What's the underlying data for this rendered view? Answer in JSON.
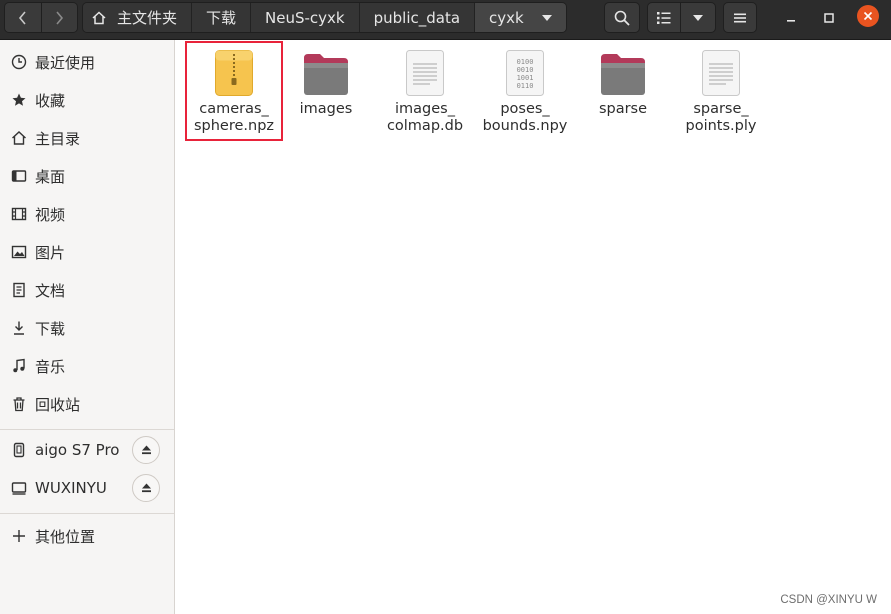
{
  "breadcrumbs": [
    "主文件夹",
    "下载",
    "NeuS-cyxk",
    "public_data",
    "cyxk"
  ],
  "sidebar": {
    "places": [
      {
        "label": "最近使用",
        "icon": "clock-icon"
      },
      {
        "label": "收藏",
        "icon": "star-icon"
      },
      {
        "label": "主目录",
        "icon": "home-icon"
      },
      {
        "label": "桌面",
        "icon": "desktop-icon"
      },
      {
        "label": "视频",
        "icon": "video-icon"
      },
      {
        "label": "图片",
        "icon": "image-icon"
      },
      {
        "label": "文档",
        "icon": "document-icon"
      },
      {
        "label": "下载",
        "icon": "download-icon"
      },
      {
        "label": "音乐",
        "icon": "music-icon"
      },
      {
        "label": "回收站",
        "icon": "trash-icon"
      }
    ],
    "devices": [
      {
        "label": "aigo S7 Pro",
        "icon": "usb-drive-icon"
      },
      {
        "label": "WUXINYU",
        "icon": "drive-icon"
      }
    ],
    "other_locations": "其他位置"
  },
  "files": [
    {
      "line1": "cameras_",
      "line2": "sphere.npz",
      "type": "archive"
    },
    {
      "line1": "images",
      "line2": "",
      "type": "folder"
    },
    {
      "line1": "images_",
      "line2": "colmap.db",
      "type": "text"
    },
    {
      "line1": "poses_",
      "line2": "bounds.npy",
      "type": "binary"
    },
    {
      "line1": "sparse",
      "line2": "",
      "type": "folder"
    },
    {
      "line1": "sparse_",
      "line2": "points.ply",
      "type": "text"
    }
  ],
  "watermark": "CSDN @XINYU W",
  "colors": {
    "header": "#2c2c2c",
    "sidebar": "#f6f5f4",
    "highlight": "#e8233a",
    "close": "#e95420"
  }
}
